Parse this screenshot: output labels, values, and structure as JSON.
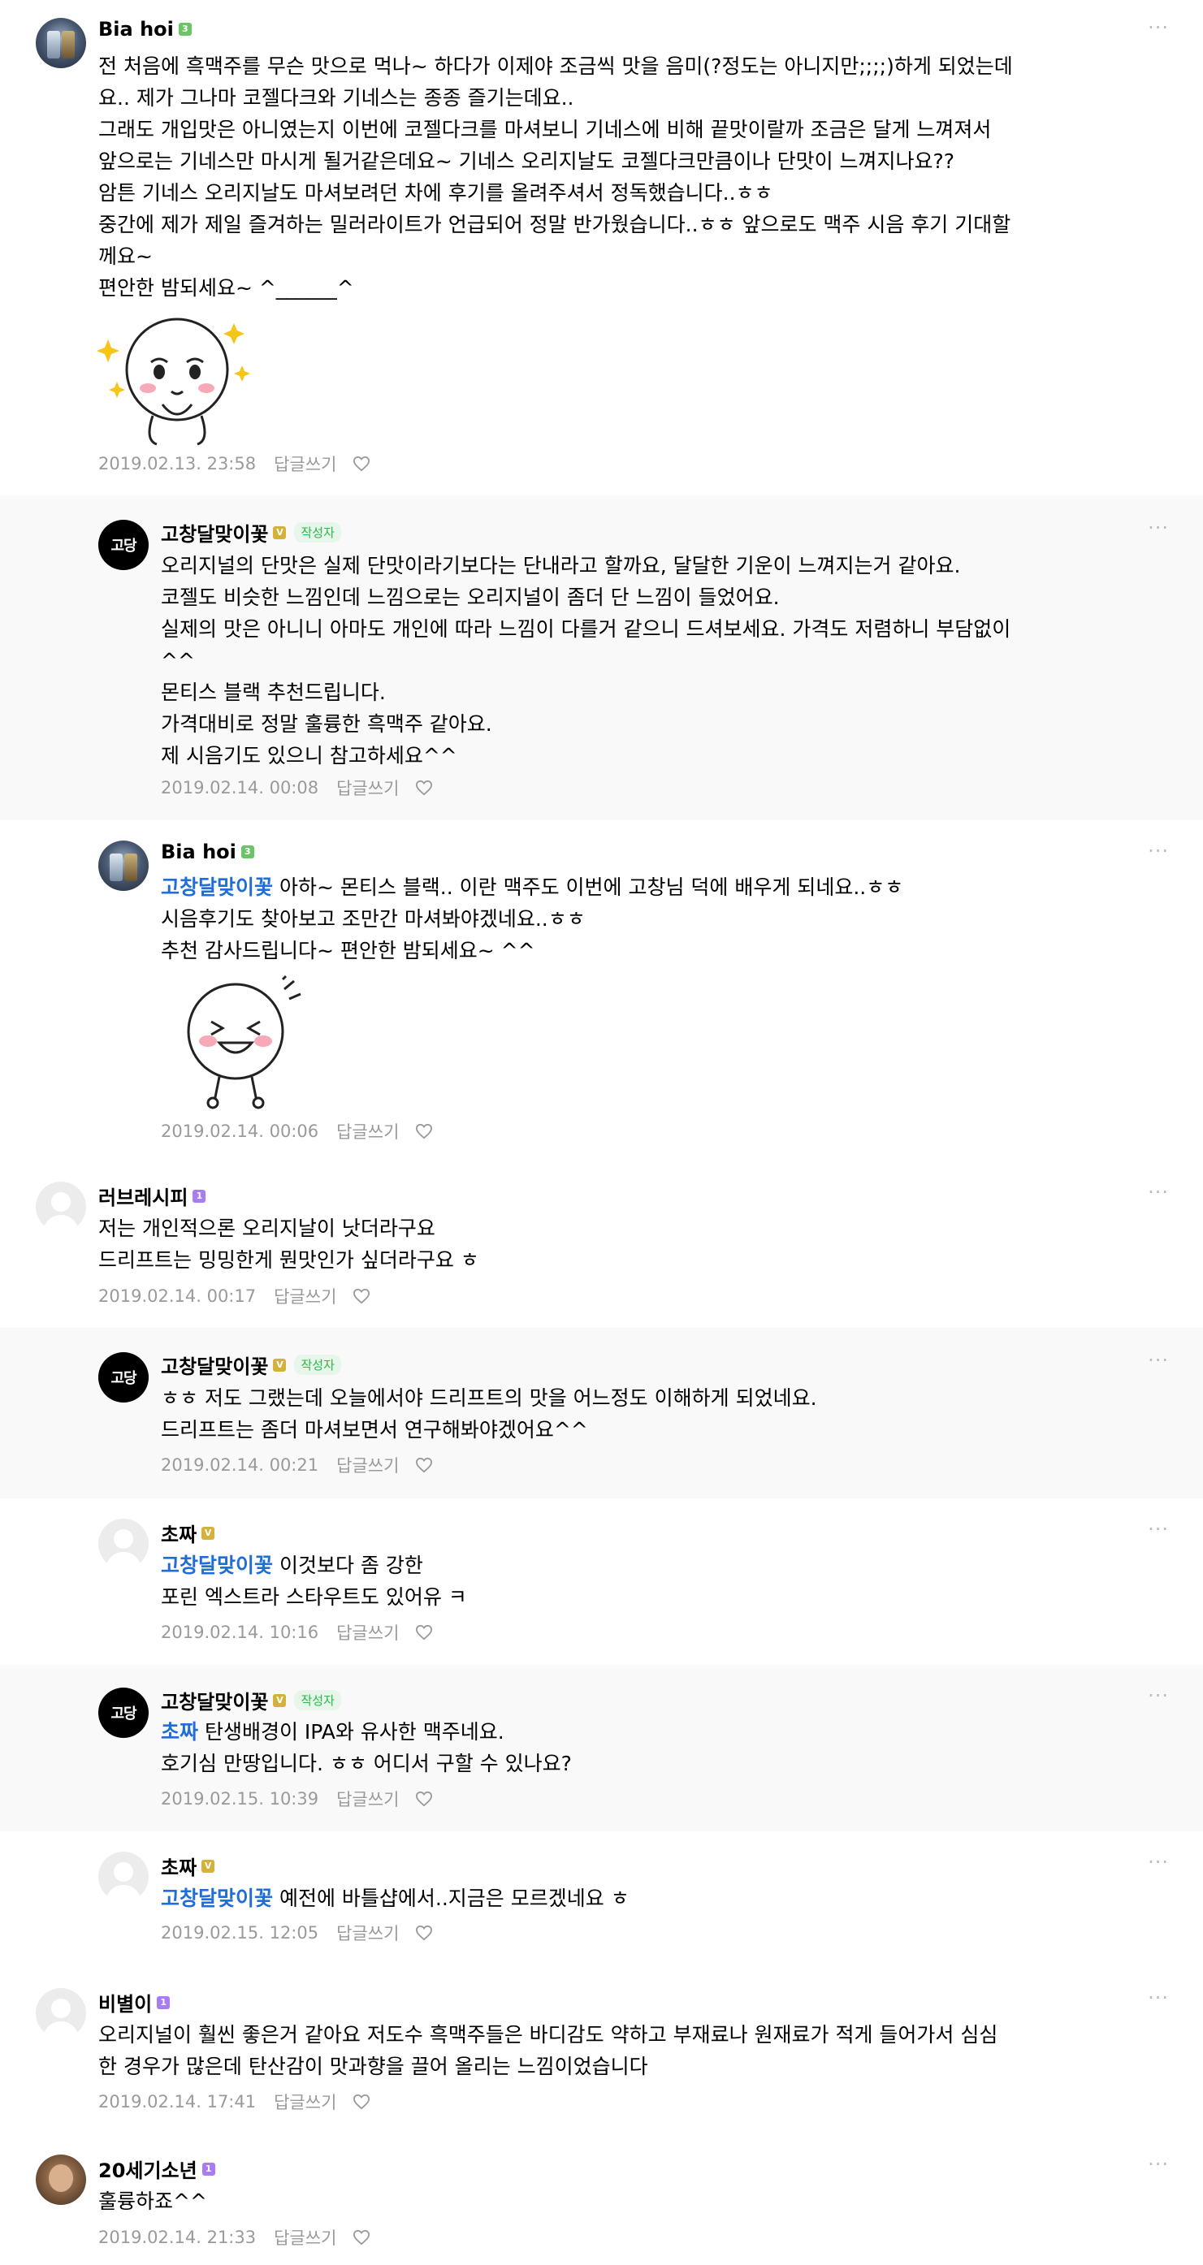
{
  "comments": [
    {
      "nick": "Bia hoi",
      "badge": "3",
      "more": "···",
      "lines": [
        "전 처음에 흑맥주를 무슨 맛으로 먹나~ 하다가 이제야 조금씩 맛을 음미(?정도는 아니지만;;;;)하게 되었는데",
        "요.. 제가 그나마 코젤다크와 기네스는 종종 즐기는데요..",
        "그래도 개입맛은 아니였는지 이번에 코젤다크를 마셔보니 기네스에 비해 끝맛이랄까 조금은 달게 느껴져서",
        "앞으로는 기네스만 마시게 될거같은데요~ 기네스 오리지날도 코젤다크만큼이나 단맛이 느껴지나요??",
        "암튼 기네스 오리지날도 마셔보려던 차에 후기를 올려주셔서 정독했습니다..ㅎㅎ",
        "중간에 제가 제일 즐겨하는 밀러라이트가 언급되어 정말 반가웠습니다..ㅎㅎ 앞으로도 맥주 시음 후기 기대할",
        "께요~",
        "편안한 밤되세요~ ^______^"
      ],
      "date": "2019.02.13. 23:58",
      "reply_label": "답글쓰기"
    },
    {
      "nick": "고창달맞이꽃",
      "badge": "V",
      "writer": "작성자",
      "avatar_text": "고당",
      "more": "···",
      "lines": [
        "오리지널의 단맛은 실제 단맛이라기보다는 단내라고 할까요, 달달한 기운이 느껴지는거 같아요.",
        "코젤도 비슷한 느낌인데 느낌으로는 오리지널이 좀더 단 느낌이 들었어요.",
        "실제의 맛은 아니니 아마도 개인에 따라 느낌이 다를거 같으니 드셔보세요. 가격도 저렴하니 부담없이",
        "^^",
        "몬티스 블랙 추천드립니다.",
        "가격대비로 정말 훌륭한 흑맥주 같아요.",
        "제 시음기도 있으니 참고하세요^^"
      ],
      "date": "2019.02.14. 00:08",
      "reply_label": "답글쓰기"
    },
    {
      "nick": "Bia hoi",
      "badge": "3",
      "more": "···",
      "mention": "고창달맞이꽃",
      "lines": [
        " 아하~ 몬티스 블랙.. 이란 맥주도 이번에 고창님 덕에 배우게 되네요..ㅎㅎ",
        "시음후기도 찾아보고 조만간 마셔봐야겠네요..ㅎㅎ",
        "추천 감사드립니다~ 편안한 밤되세요~ ^^"
      ],
      "date": "2019.02.14. 00:06",
      "reply_label": "답글쓰기"
    },
    {
      "nick": "러브레시피",
      "badge": "1",
      "more": "···",
      "lines": [
        "저는 개인적으론 오리지날이 낫더라구요",
        "드리프트는 밍밍한게 뭔맛인가 싶더라구요 ㅎ"
      ],
      "date": "2019.02.14. 00:17",
      "reply_label": "답글쓰기"
    },
    {
      "nick": "고창달맞이꽃",
      "badge": "V",
      "writer": "작성자",
      "avatar_text": "고당",
      "more": "···",
      "lines": [
        "ㅎㅎ 저도 그랬는데 오늘에서야 드리프트의 맛을 어느정도 이해하게 되었네요.",
        "드리프트는 좀더 마셔보면서 연구해봐야겠어요^^"
      ],
      "date": "2019.02.14. 00:21",
      "reply_label": "답글쓰기"
    },
    {
      "nick": "초짜",
      "badge": "V",
      "more": "···",
      "mention": "고창달맞이꽃",
      "lines": [
        " 이것보다 좀 강한",
        "포린 엑스트라 스타우트도 있어유 ㅋ"
      ],
      "date": "2019.02.14. 10:16",
      "reply_label": "답글쓰기"
    },
    {
      "nick": "고창달맞이꽃",
      "badge": "V",
      "writer": "작성자",
      "avatar_text": "고당",
      "more": "···",
      "mention": "초짜",
      "lines": [
        " 탄생배경이 IPA와 유사한 맥주네요.",
        "호기심 만땅입니다. ㅎㅎ 어디서 구할 수 있나요?"
      ],
      "date": "2019.02.15. 10:39",
      "reply_label": "답글쓰기"
    },
    {
      "nick": "초짜",
      "badge": "V",
      "more": "···",
      "mention": "고창달맞이꽃",
      "lines": [
        " 예전에 바틀샵에서..지금은 모르겠네요 ㅎ"
      ],
      "date": "2019.02.15. 12:05",
      "reply_label": "답글쓰기"
    },
    {
      "nick": "비별이",
      "badge": "1",
      "more": "···",
      "lines": [
        "오리지널이 훨씬 좋은거 같아요 저도수 흑맥주들은 바디감도 약하고 부재료나 원재료가 적게 들어가서 심심",
        "한 경우가 많은데 탄산감이 맛과향을 끌어 올리는 느낌이었습니다"
      ],
      "date": "2019.02.14. 17:41",
      "reply_label": "답글쓰기"
    },
    {
      "nick": "20세기소년",
      "badge": "1",
      "more": "···",
      "lines": [
        "훌륭하죠^^"
      ],
      "date": "2019.02.14. 21:33",
      "reply_label": "답글쓰기"
    }
  ]
}
